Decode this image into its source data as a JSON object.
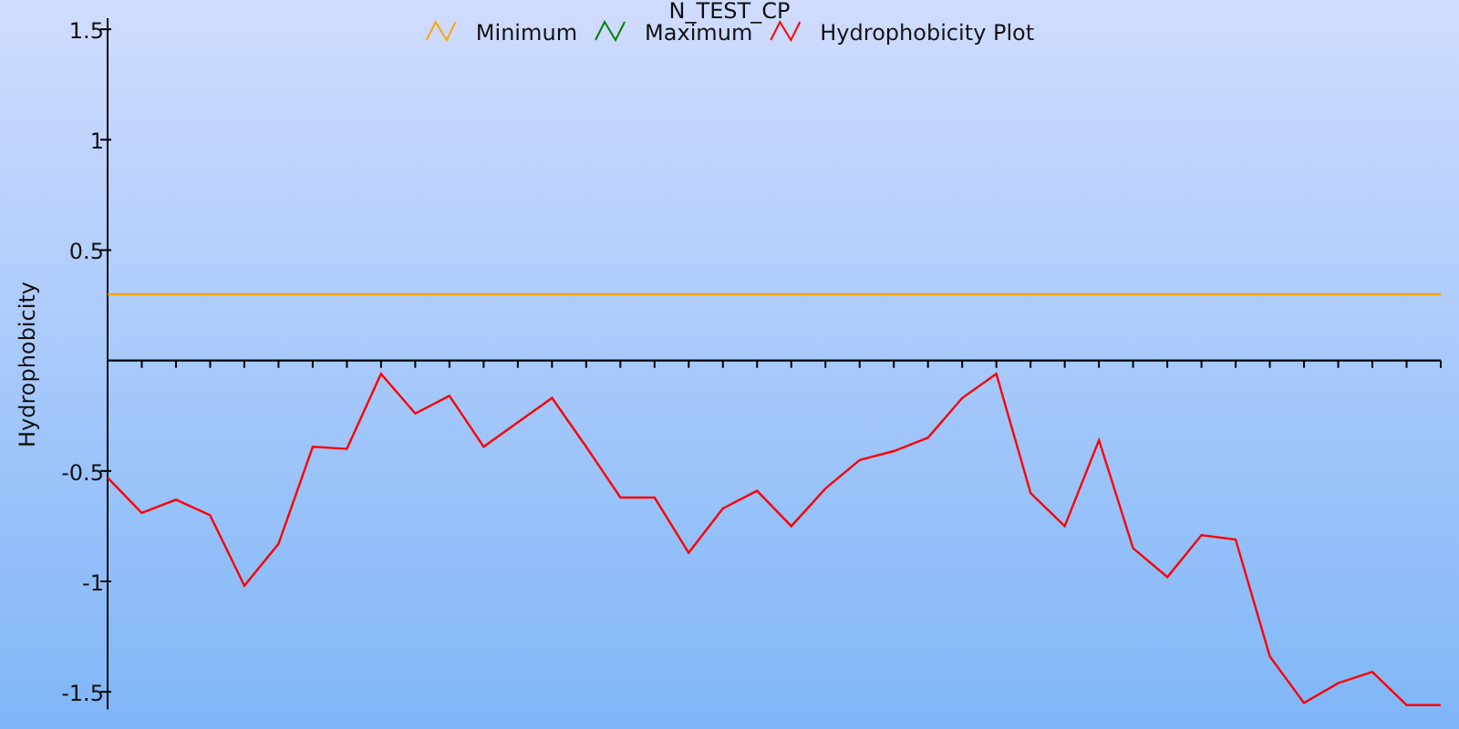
{
  "chart_data": {
    "type": "line",
    "title": "N_TEST_CP",
    "ylabel": "Hydrophobicity",
    "categories": [
      null,
      null,
      null,
      null,
      null,
      null,
      null,
      null,
      null,
      null,
      null,
      null,
      null,
      null,
      null,
      null,
      null,
      null,
      null,
      null,
      null,
      null,
      null,
      null,
      null,
      null,
      null,
      null,
      null,
      null,
      null,
      null,
      null,
      null,
      null,
      null,
      null,
      null,
      null,
      null
    ],
    "legend": "top",
    "ylim": [
      -1.58,
      1.55
    ],
    "yticks": [
      -1.5,
      -1,
      -0.5,
      0.5,
      1,
      1.5
    ],
    "series": [
      {
        "name": "Minimum",
        "color": "#ffa500",
        "values": [
          0.3,
          0.3,
          0.3,
          0.3,
          0.3,
          0.3,
          0.3,
          0.3,
          0.3,
          0.3,
          0.3,
          0.3,
          0.3,
          0.3,
          0.3,
          0.3,
          0.3,
          0.3,
          0.3,
          0.3,
          0.3,
          0.3,
          0.3,
          0.3,
          0.3,
          0.3,
          0.3,
          0.3,
          0.3,
          0.3,
          0.3,
          0.3,
          0.3,
          0.3,
          0.3,
          0.3,
          0.3,
          0.3,
          0.3,
          0.3
        ]
      },
      {
        "name": "Maximum",
        "color": "#008000",
        "values": [
          null,
          null,
          null,
          null,
          null,
          null,
          null,
          null,
          null,
          null,
          null,
          null,
          null,
          null,
          null,
          null,
          null,
          null,
          null,
          null,
          null,
          null,
          null,
          null,
          null,
          null,
          null,
          null,
          null,
          null,
          null,
          null,
          null,
          null,
          null,
          null,
          null,
          null,
          null,
          null
        ]
      },
      {
        "name": "Hydrophobicity Plot",
        "color": "#ff0000",
        "values": [
          -0.53,
          -0.69,
          -0.63,
          -0.7,
          -1.02,
          -0.83,
          -0.39,
          -0.4,
          -0.06,
          -0.24,
          -0.16,
          -0.39,
          -0.28,
          -0.17,
          -0.39,
          -0.62,
          -0.62,
          -0.87,
          -0.67,
          -0.59,
          -0.75,
          -0.58,
          -0.45,
          -0.41,
          -0.35,
          -0.17,
          -0.06,
          -0.6,
          -0.75,
          -0.36,
          -0.85,
          -0.98,
          -0.79,
          -0.81,
          -1.34,
          -1.55,
          -1.46,
          -1.41,
          -1.56,
          -1.56
        ]
      }
    ]
  }
}
